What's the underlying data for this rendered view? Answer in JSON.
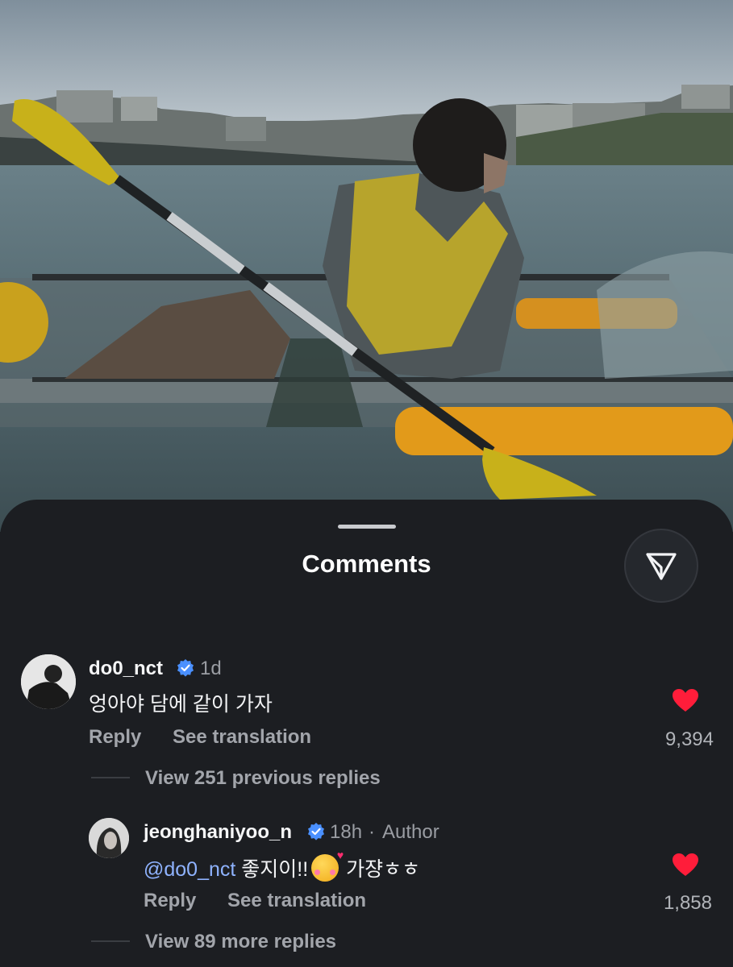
{
  "sheet": {
    "title": "Comments"
  },
  "icons": {
    "share": "send-icon",
    "verified": "verified-badge-icon",
    "like": "heart-icon"
  },
  "colors": {
    "background": "#1c1e22",
    "like_heart": "#ff1d3a",
    "mention": "#8fb3ff",
    "verified": "#4a90ff"
  },
  "comments": [
    {
      "username": "do0_nct",
      "verified": true,
      "time": "1d",
      "text": "엉아야 담에 같이 가자",
      "reply_label": "Reply",
      "translate_label": "See translation",
      "liked": true,
      "likes": "9,394",
      "view_replies": "View 251 previous replies"
    }
  ],
  "replies": [
    {
      "username": "jeonghaniyoo_n",
      "verified": true,
      "time": "18h",
      "separator": "·",
      "badge": "Author",
      "mention": "@do0_nct",
      "text_before_emoji": "좋지이!!",
      "emoji": "smiling-face-with-hearts",
      "text_after_emoji": "가쟝ㅎㅎ",
      "reply_label": "Reply",
      "translate_label": "See translation",
      "liked": true,
      "likes": "1,858",
      "view_replies": "View 89 more replies"
    }
  ]
}
